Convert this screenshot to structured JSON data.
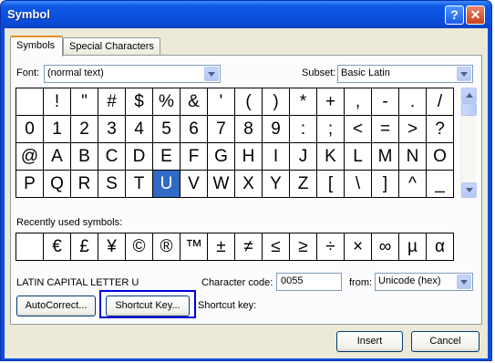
{
  "window": {
    "title": "Symbol",
    "help_glyph": "?",
    "close_glyph": "✕"
  },
  "tabs": [
    "Symbols",
    "Special Characters"
  ],
  "font": {
    "label": "Font:",
    "value": "(normal text)"
  },
  "subset": {
    "label": "Subset:",
    "value": "Basic Latin"
  },
  "symbols": [
    " ",
    "!",
    "\"",
    "#",
    "$",
    "%",
    "&",
    "'",
    "(",
    ")",
    "*",
    "+",
    ",",
    "-",
    ".",
    "/",
    "0",
    "1",
    "2",
    "3",
    "4",
    "5",
    "6",
    "7",
    "8",
    "9",
    ":",
    ";",
    "<",
    "=",
    ">",
    "?",
    "@",
    "A",
    "B",
    "C",
    "D",
    "E",
    "F",
    "G",
    "H",
    "I",
    "J",
    "K",
    "L",
    "M",
    "N",
    "O",
    "P",
    "Q",
    "R",
    "S",
    "T",
    "U",
    "V",
    "W",
    "X",
    "Y",
    "Z",
    "[",
    "\\",
    "]",
    "^",
    "_"
  ],
  "selected_symbol": "U",
  "recently_used": {
    "label": "Recently used symbols:",
    "symbols": [
      " ",
      "€",
      "£",
      "¥",
      "©",
      "®",
      "™",
      "±",
      "≠",
      "≤",
      "≥",
      "÷",
      "×",
      "∞",
      "µ",
      "α"
    ]
  },
  "char_name": "LATIN CAPITAL LETTER U",
  "character_code": {
    "label": "Character code:",
    "value": "0055"
  },
  "from": {
    "label": "from:",
    "value": "Unicode (hex)"
  },
  "buttons": {
    "autocorrect": "AutoCorrect...",
    "shortcut_key": "Shortcut Key...",
    "insert": "Insert",
    "cancel": "Cancel"
  },
  "shortcut_key_label": "Shortcut key:"
}
